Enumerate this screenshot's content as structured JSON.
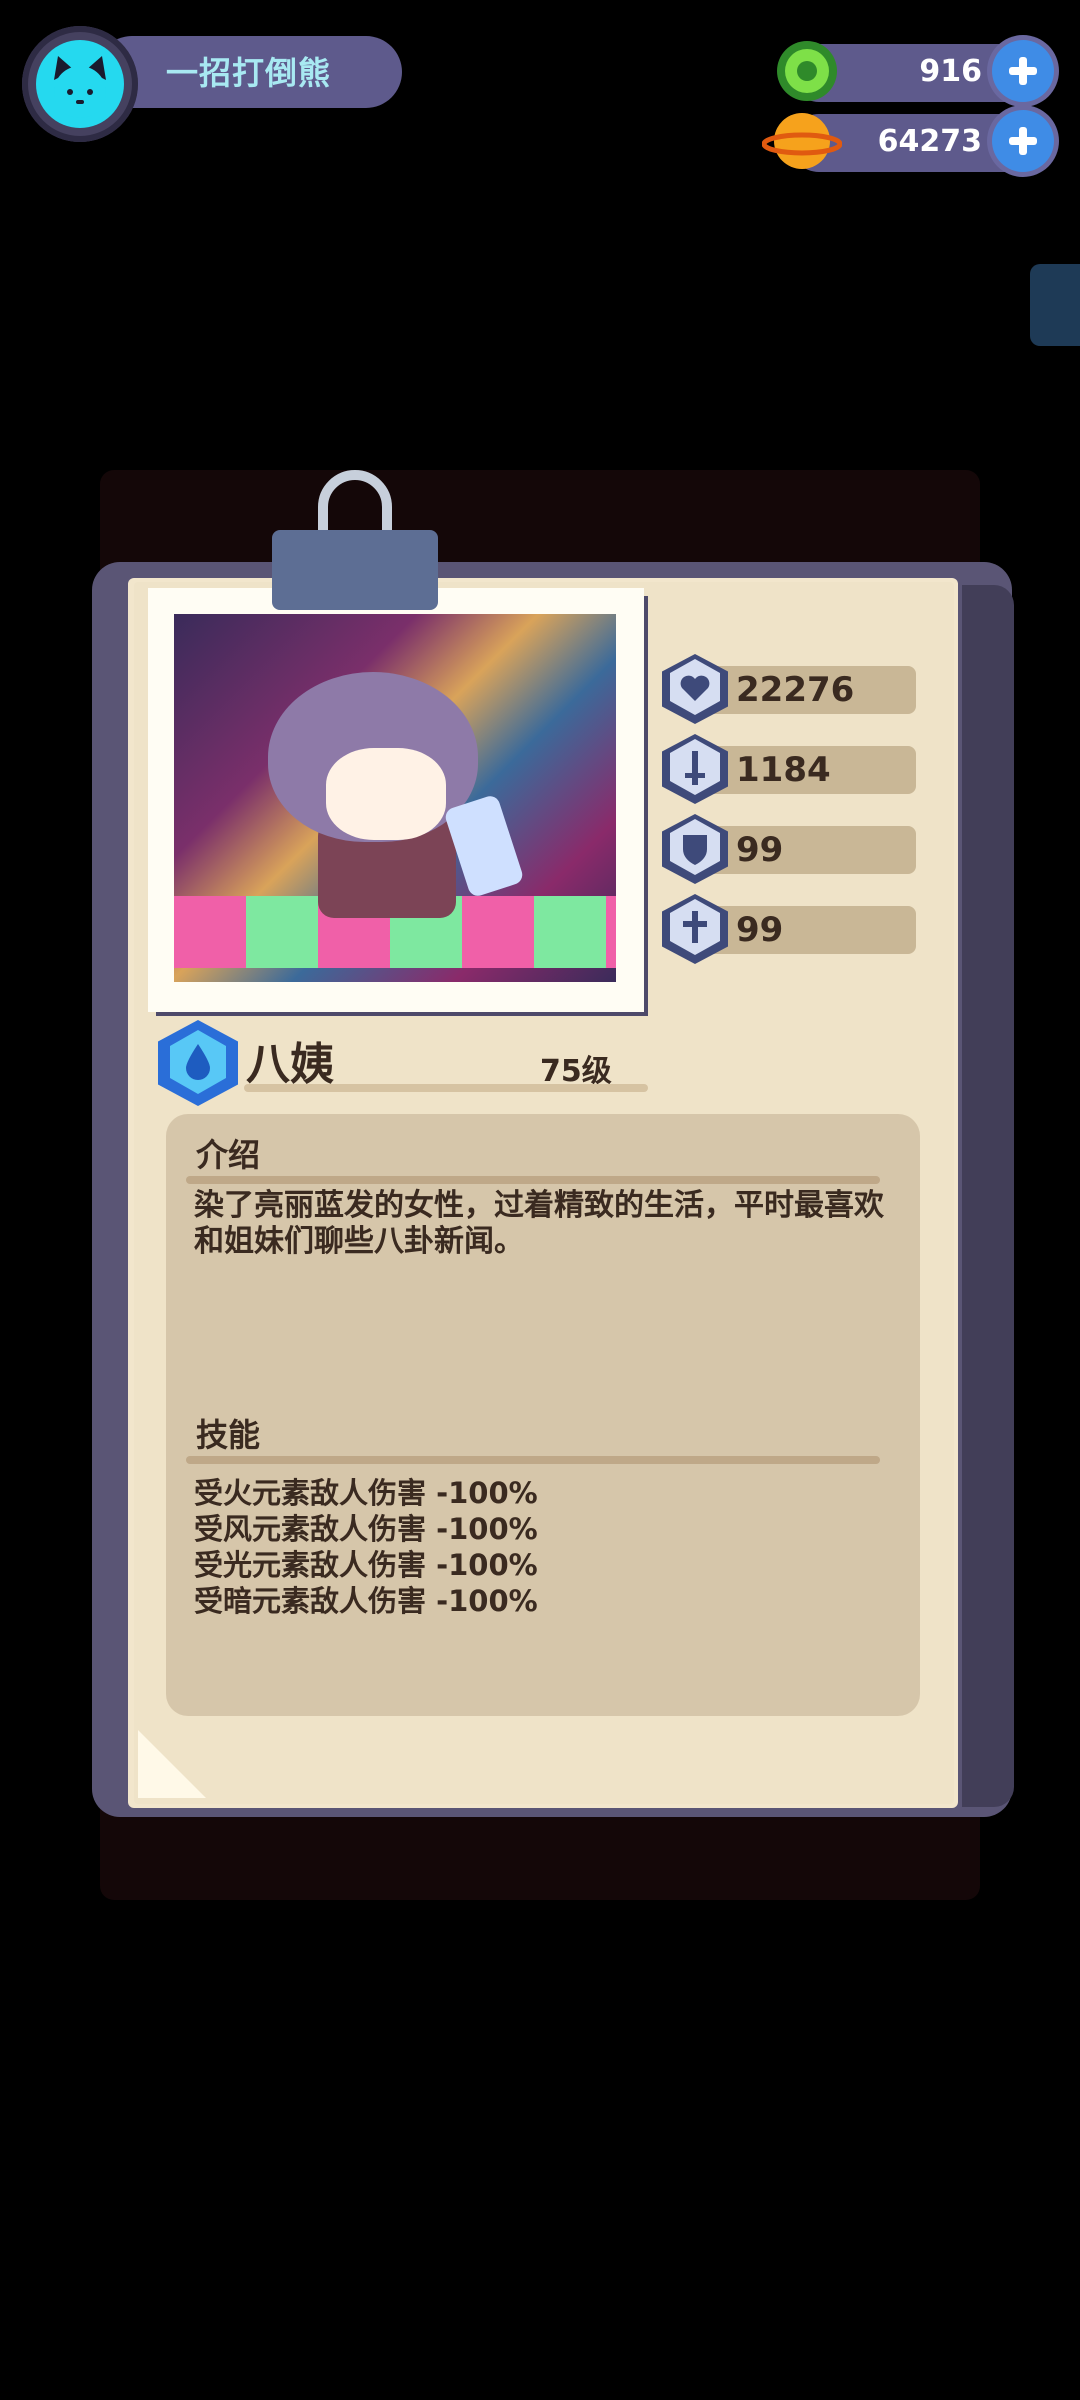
{
  "player": {
    "name": "一招打倒熊"
  },
  "currencies": [
    {
      "icon": "green-gem-coin-icon",
      "value": "916"
    },
    {
      "icon": "orange-planet-coin-icon",
      "value": "64273"
    }
  ],
  "hero": {
    "name": "八姨",
    "level": "75级",
    "element_icon": "water-element-icon",
    "stats": [
      {
        "icon": "heart-icon",
        "value": "22276"
      },
      {
        "icon": "sword-icon",
        "value": "1184"
      },
      {
        "icon": "shield-icon",
        "value": "99"
      },
      {
        "icon": "cross-guard-icon",
        "value": "99"
      }
    ],
    "intro_heading": "介绍",
    "intro_text": "染了亮丽蓝发的女性，过着精致的生活，平时最喜欢和姐妹们聊些八卦新闻。",
    "skills_heading": "技能",
    "skills": [
      "受火元素敌人伤害 -100%",
      "受风元素敌人伤害 -100%",
      "受光元素敌人伤害 -100%",
      "受暗元素敌人伤害 -100%"
    ]
  },
  "colors": {
    "panel_bg": "#d6c6aa",
    "paper": "#f2e6cc",
    "board": "#5a5575",
    "accent_blue": "#3f8ce6",
    "name_text": "#a8e9f2"
  }
}
